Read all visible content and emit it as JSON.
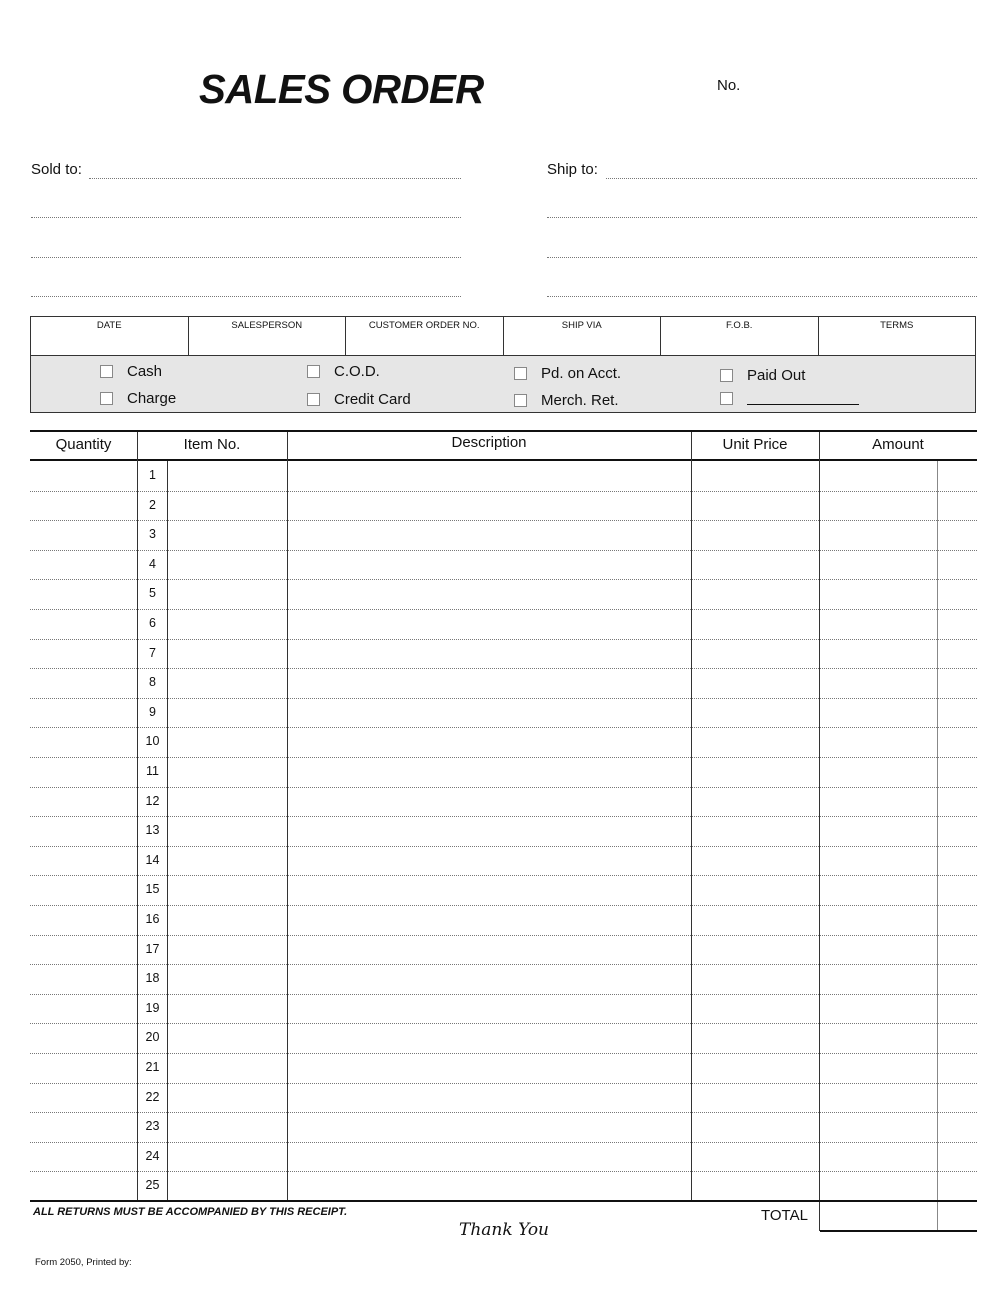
{
  "form": {
    "title": "SALES ORDER",
    "number_label": "No.",
    "sold_to_label": "Sold to:",
    "ship_to_label": "Ship to:"
  },
  "info_fields": [
    "DATE",
    "SALESPERSON",
    "CUSTOMER ORDER NO.",
    "SHIP VIA",
    "F.O.B.",
    "TERMS"
  ],
  "payment_options": {
    "cash": "Cash",
    "charge": "Charge",
    "cod": "C.O.D.",
    "credit_card": "Credit Card",
    "pd_on_acct": "Pd. on Acct.",
    "merch_ret": "Merch. Ret.",
    "paid_out": "Paid Out",
    "other": ""
  },
  "table": {
    "columns": [
      "Quantity",
      "Item No.",
      "Description",
      "Unit Price",
      "Amount"
    ],
    "row_numbers": [
      "1",
      "2",
      "3",
      "4",
      "5",
      "6",
      "7",
      "8",
      "9",
      "10",
      "11",
      "12",
      "13",
      "14",
      "15",
      "16",
      "17",
      "18",
      "19",
      "20",
      "21",
      "22",
      "23",
      "24",
      "25"
    ]
  },
  "footer": {
    "returns_notice": "ALL RETURNS MUST BE ACCOMPANIED BY THIS RECEIPT.",
    "total_label": "TOTAL",
    "thank_you": "Thank You",
    "form_note": "Form 2050, Printed by:"
  }
}
